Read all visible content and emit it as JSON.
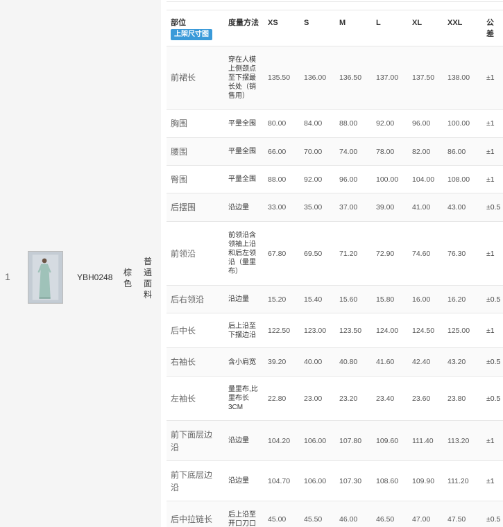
{
  "product_row": {
    "index": "1",
    "sku": "YBH0248",
    "color": "棕色",
    "fabric": "普通面料"
  },
  "table": {
    "headers": {
      "part": "部位",
      "method": "度量方法",
      "xs": "XS",
      "s": "S",
      "m": "M",
      "l": "L",
      "xl": "XL",
      "xxl": "XXL",
      "tolerance": "公差"
    },
    "size_chart_button": "上架尺寸图",
    "rows": [
      {
        "part": "前裙长",
        "method": "穿在人模上侧颈点至下摆最长处（销售用）",
        "xs": "135.50",
        "s": "136.00",
        "m": "136.50",
        "l": "137.00",
        "xl": "137.50",
        "xxl": "138.00",
        "tol": "±1"
      },
      {
        "part": "胸围",
        "method": "平量全围",
        "xs": "80.00",
        "s": "84.00",
        "m": "88.00",
        "l": "92.00",
        "xl": "96.00",
        "xxl": "100.00",
        "tol": "±1"
      },
      {
        "part": "腰围",
        "method": "平量全围",
        "xs": "66.00",
        "s": "70.00",
        "m": "74.00",
        "l": "78.00",
        "xl": "82.00",
        "xxl": "86.00",
        "tol": "±1"
      },
      {
        "part": "臀围",
        "method": "平量全围",
        "xs": "88.00",
        "s": "92.00",
        "m": "96.00",
        "l": "100.00",
        "xl": "104.00",
        "xxl": "108.00",
        "tol": "±1"
      },
      {
        "part": "后摆围",
        "method": "沿边量",
        "xs": "33.00",
        "s": "35.00",
        "m": "37.00",
        "l": "39.00",
        "xl": "41.00",
        "xxl": "43.00",
        "tol": "±0.5"
      },
      {
        "part": "前领沿",
        "method": "前领沿含领袖上沿和后左领沿（量里布）",
        "xs": "67.80",
        "s": "69.50",
        "m": "71.20",
        "l": "72.90",
        "xl": "74.60",
        "xxl": "76.30",
        "tol": "±1"
      },
      {
        "part": "后右领沿",
        "method": "沿边量",
        "xs": "15.20",
        "s": "15.40",
        "m": "15.60",
        "l": "15.80",
        "xl": "16.00",
        "xxl": "16.20",
        "tol": "±0.5"
      },
      {
        "part": "后中长",
        "method": "后上沿至下摆边沿",
        "xs": "122.50",
        "s": "123.00",
        "m": "123.50",
        "l": "124.00",
        "xl": "124.50",
        "xxl": "125.00",
        "tol": "±1"
      },
      {
        "part": "右袖长",
        "method": "含小肩宽",
        "xs": "39.20",
        "s": "40.00",
        "m": "40.80",
        "l": "41.60",
        "xl": "42.40",
        "xxl": "43.20",
        "tol": "±0.5"
      },
      {
        "part": "左袖长",
        "method": "量里布,比里布长3CM",
        "xs": "22.80",
        "s": "23.00",
        "m": "23.20",
        "l": "23.40",
        "xl": "23.60",
        "xxl": "23.80",
        "tol": "±0.5"
      },
      {
        "part": "前下面层边沿",
        "method": "沿边量",
        "xs": "104.20",
        "s": "106.00",
        "m": "107.80",
        "l": "109.60",
        "xl": "111.40",
        "xxl": "113.20",
        "tol": "±1"
      },
      {
        "part": "前下底层边沿",
        "method": "沿边量",
        "xs": "104.70",
        "s": "106.00",
        "m": "107.30",
        "l": "108.60",
        "xl": "109.90",
        "xxl": "111.20",
        "tol": "±1"
      },
      {
        "part": "后中拉链长",
        "method": "后上沿至开口刀口",
        "xs": "45.00",
        "s": "45.50",
        "m": "46.00",
        "l": "46.50",
        "xl": "47.00",
        "xxl": "47.50",
        "tol": "±0.5"
      }
    ]
  }
}
